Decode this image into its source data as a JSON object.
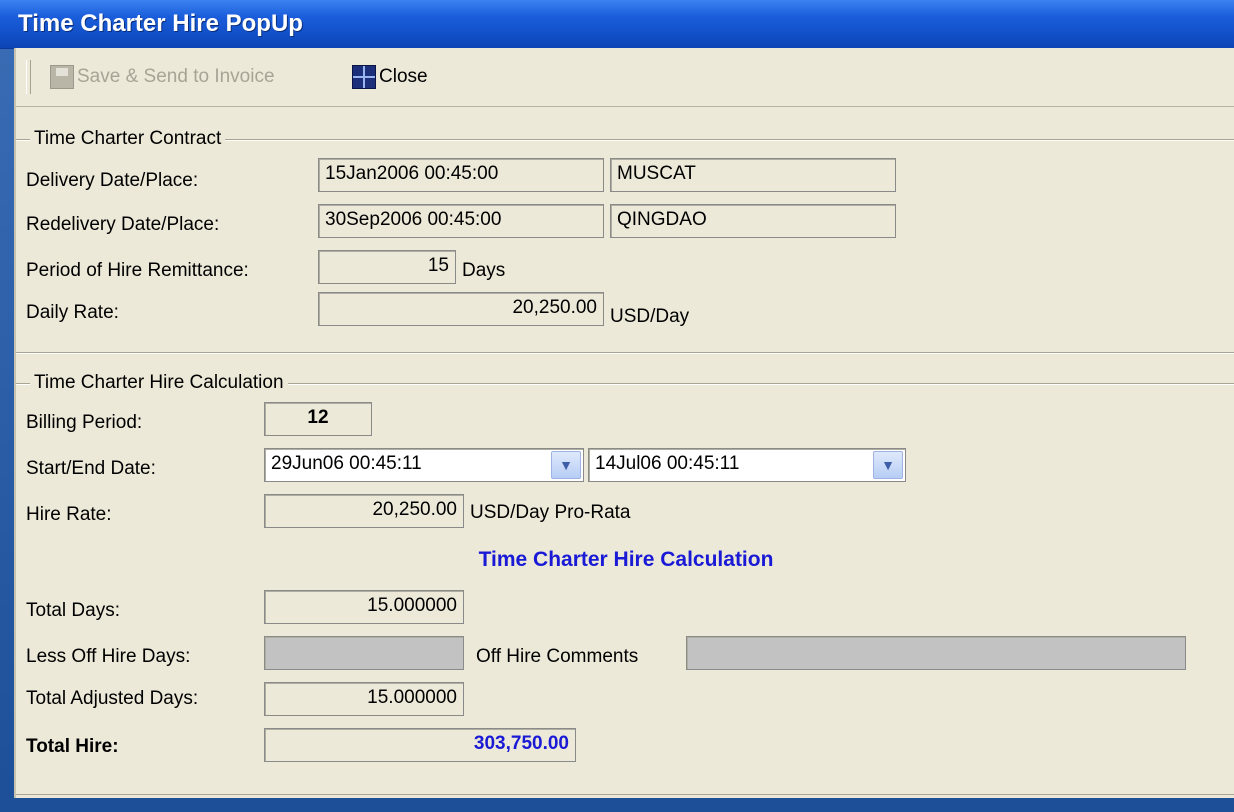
{
  "window": {
    "title": "Time Charter Hire PopUp"
  },
  "toolbar": {
    "save_label": "Save & Send to Invoice",
    "save_icon": "disk-icon",
    "close_label": "Close",
    "close_icon": "grid-icon"
  },
  "contract": {
    "group_title": "Time Charter Contract",
    "delivery_label": "Delivery Date/Place:",
    "delivery_date": "15Jan2006 00:45:00",
    "delivery_place": "MUSCAT",
    "redelivery_label": "Redelivery Date/Place:",
    "redelivery_date": "30Sep2006 00:45:00",
    "redelivery_place": "QINGDAO",
    "remittance_label": "Period of Hire Remittance:",
    "remittance_value": "15",
    "remittance_unit": "Days",
    "daily_rate_label": "Daily Rate:",
    "daily_rate_value": "20,250.00",
    "daily_rate_unit": "USD/Day"
  },
  "calculation": {
    "group_title": "Time Charter Hire Calculation",
    "billing_period_label": "Billing Period:",
    "billing_period_value": "12",
    "start_end_label": "Start/End Date:",
    "start_date": "29Jun06 00:45:11",
    "end_date": "14Jul06 00:45:11",
    "hire_rate_label": "Hire Rate:",
    "hire_rate_value": "20,250.00",
    "hire_rate_unit": "USD/Day Pro-Rata",
    "heading": "Time Charter Hire Calculation",
    "total_days_label": "Total Days:",
    "total_days_value": "15.000000",
    "off_hire_days_label": "Less Off Hire Days:",
    "off_hire_days_value": "",
    "off_hire_comments_label": "Off Hire Comments",
    "off_hire_comments_value": "",
    "adjusted_days_label": "Total Adjusted Days:",
    "adjusted_days_value": "15.000000",
    "total_hire_label": "Total Hire:",
    "total_hire_value": "303,750.00"
  },
  "colors": {
    "title_bar": "#1a5ddb",
    "panel": "#ece9d8",
    "accent_blue": "#1a1ad6"
  }
}
